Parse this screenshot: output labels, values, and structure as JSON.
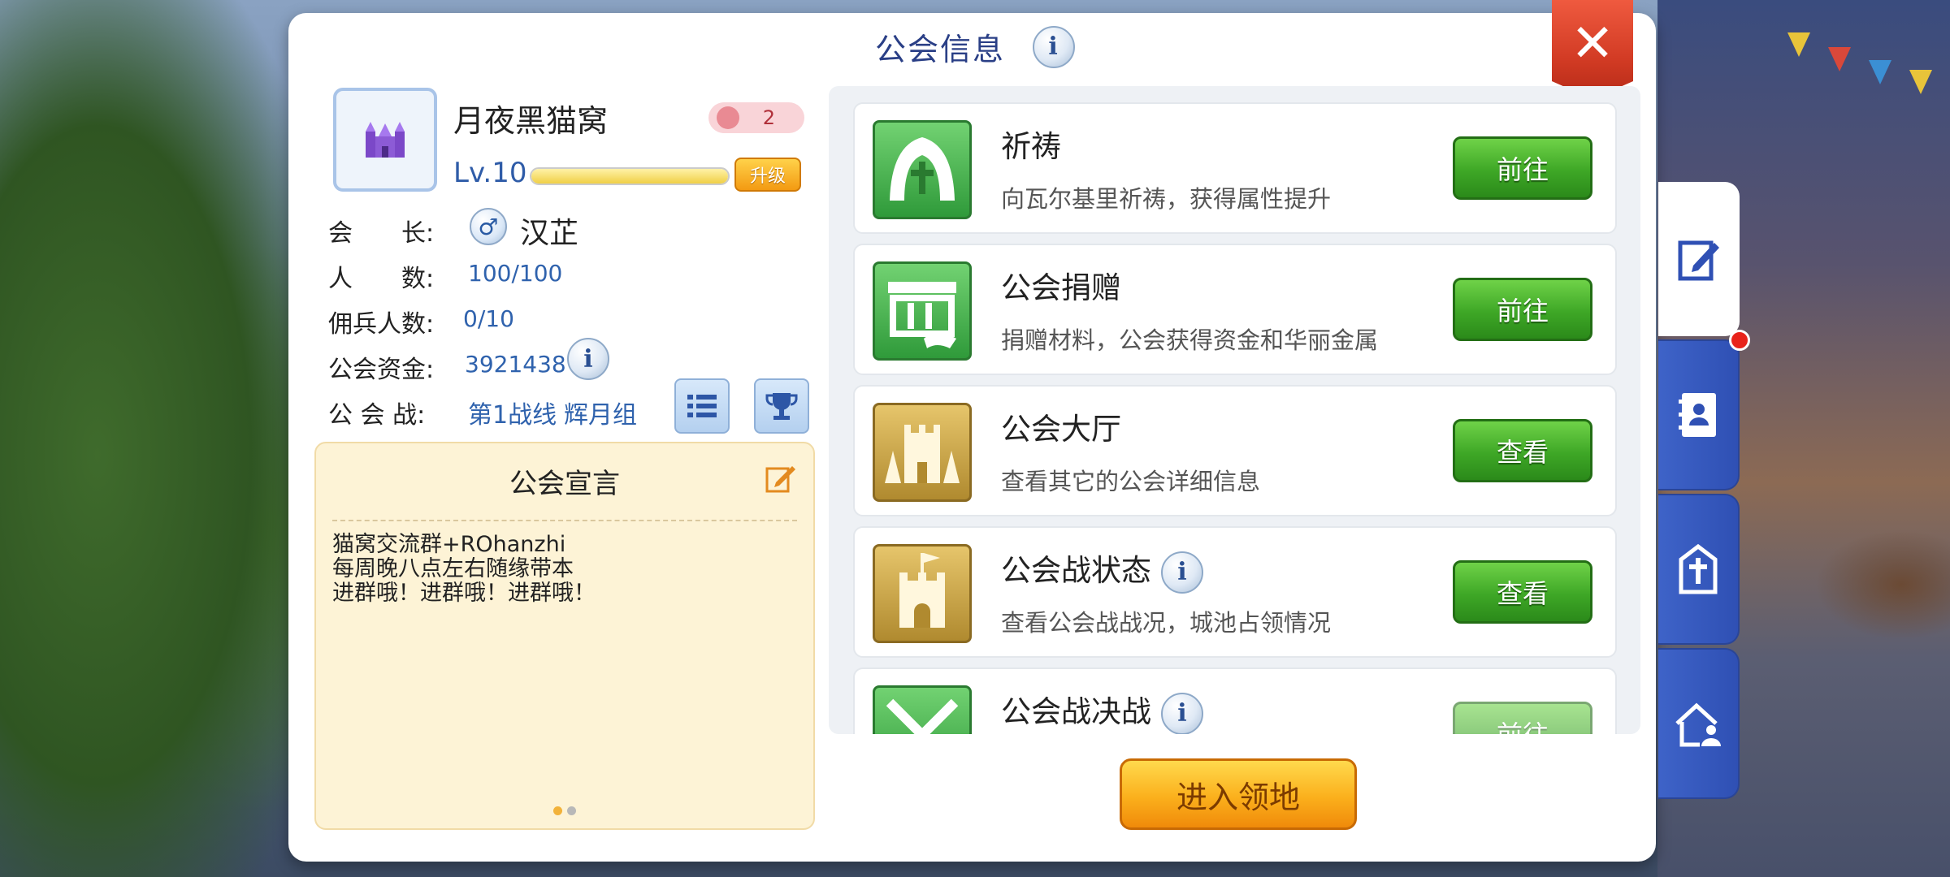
{
  "panel": {
    "title": "公会信息"
  },
  "guild": {
    "name": "月夜黑猫窝",
    "rank": "2",
    "level": "Lv.10",
    "level_progress": 1.0,
    "upgrade_label": "升级"
  },
  "info": {
    "leader_label": "会　　长:",
    "leader_name": "汉芷",
    "members_label": "人　　数:",
    "members_value": "100/100",
    "mercenary_label": "佣兵人数:",
    "mercenary_value": "0/10",
    "funds_label": "公会资金:",
    "funds_value": "3921438",
    "war_label": "公 会 战:",
    "war_line": "第1战线",
    "war_group": "辉月组"
  },
  "declaration": {
    "title": "公会宣言",
    "text": "猫窝交流群+ROhanzhi\n每周晚八点左右随缘带本\n进群哦！进群哦！进群哦！",
    "page_count": 2,
    "current_page": 1
  },
  "features": [
    {
      "title": "祈祷",
      "desc": "向瓦尔基里祈祷，获得属性提升",
      "button": "前往",
      "icon": "prayer-icon",
      "has_info": false
    },
    {
      "title": "公会捐赠",
      "desc": "捐赠材料，公会获得资金和华丽金属",
      "button": "前往",
      "icon": "donate-icon",
      "has_info": false
    },
    {
      "title": "公会大厅",
      "desc": "查看其它的公会详细信息",
      "button": "查看",
      "icon": "castle-icon",
      "has_info": false
    },
    {
      "title": "公会战状态",
      "desc": "查看公会战战况，城池占领情况",
      "button": "查看",
      "icon": "tower-icon",
      "has_info": true
    },
    {
      "title": "公会战决战",
      "desc": "",
      "button": "前往",
      "icon": "crossed-swords-icon",
      "has_info": true
    }
  ],
  "enter_button": "进入领地",
  "colors": {
    "accent_blue": "#2f62ad",
    "button_green": "#3ea726",
    "button_orange": "#fbb01c",
    "close_red": "#d23b24"
  }
}
